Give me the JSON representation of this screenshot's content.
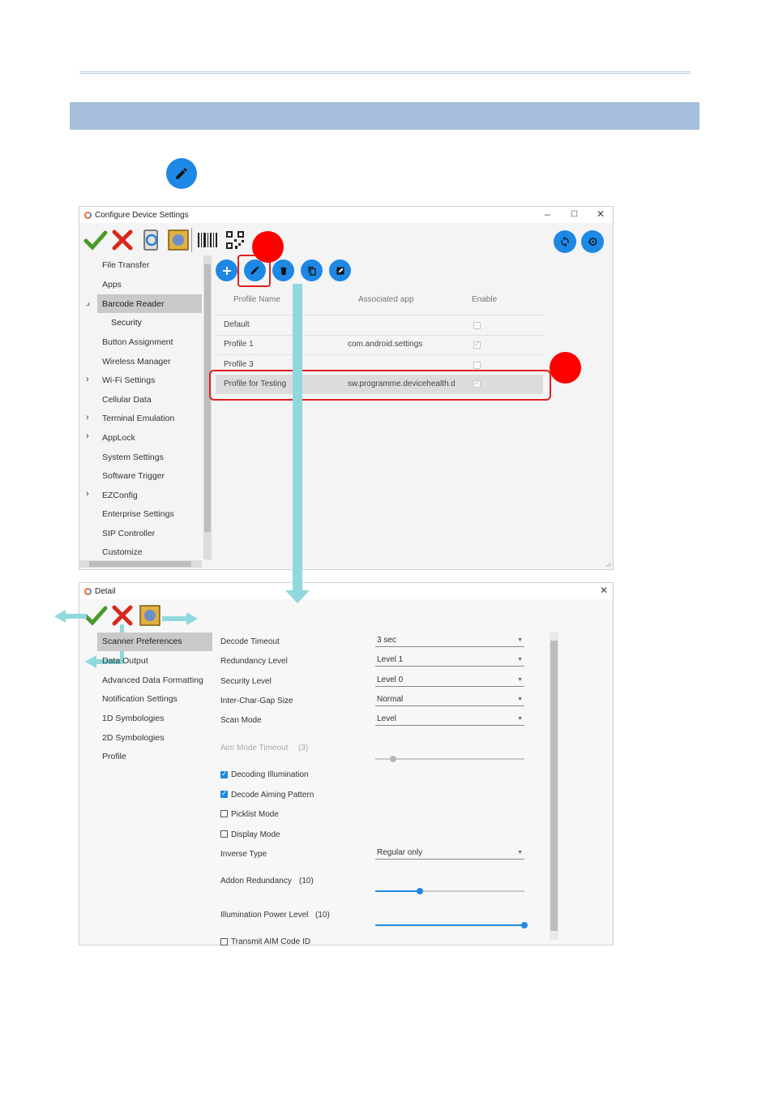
{
  "window1": {
    "title": "Configure Device Settings",
    "nav": [
      "File Transfer",
      "Apps",
      "Barcode Reader",
      "Security",
      "Button Assignment",
      "Wireless Manager",
      "Wi-Fi Settings",
      "Cellular Data",
      "Terminal Emulation",
      "AppLock",
      "System Settings",
      "Software Trigger",
      "EZConfig",
      "Enterprise Settings",
      "SIP Controller",
      "Customize"
    ],
    "columns": {
      "name": "Profile Name",
      "app": "Associated app",
      "enable": "Enable"
    },
    "profiles": [
      {
        "name": "Default",
        "app": "",
        "enabled": false
      },
      {
        "name": "Profile 1",
        "app": "com.android.settings",
        "enabled": true
      },
      {
        "name": "Profile 3",
        "app": "",
        "enabled": false
      },
      {
        "name": "Profile for Testing",
        "app": "sw.programme.devicehealth.da",
        "enabled": true
      }
    ]
  },
  "window2": {
    "title": "Detail",
    "nav": [
      "Scanner Preferences",
      "Data Output",
      "Advanced Data Formatting",
      "Notification Settings",
      "1D Symbologies",
      "2D Symbologies",
      "Profile"
    ],
    "settings": {
      "decode_timeout": {
        "label": "Decode Timeout",
        "value": "3 sec"
      },
      "redundancy": {
        "label": "Redundancy Level",
        "value": "Level 1"
      },
      "security": {
        "label": "Security Level",
        "value": "Level 0"
      },
      "inter_char": {
        "label": "Inter-Char-Gap Size",
        "value": "Normal"
      },
      "scan_mode": {
        "label": "Scan Mode",
        "value": "Level"
      },
      "aim_timeout": {
        "label": "Aim Mode Timeout",
        "value": "(3)",
        "fraction": 0.12
      },
      "decoding_illum": {
        "label": "Decoding Illumination",
        "checked": true
      },
      "aiming_pattern": {
        "label": "Decode Aiming Pattern",
        "checked": true
      },
      "picklist": {
        "label": "Picklist Mode",
        "checked": false
      },
      "display_mode": {
        "label": "Display Mode",
        "checked": false
      },
      "inverse": {
        "label": "Inverse Type",
        "value": "Regular only"
      },
      "addon": {
        "label": "Addon Redundancy",
        "value": "(10)",
        "fraction": 0.3
      },
      "illum_power": {
        "label": "Illumination Power Level",
        "value": "(10)",
        "fraction": 1.0
      },
      "transmit_aim": {
        "label": "Transmit AIM Code ID",
        "checked": false
      }
    }
  },
  "colors": {
    "accent": "#1e88e5",
    "highlight": "#e02020",
    "arrow": "#8fd8dc",
    "band": "#a5bfdd"
  }
}
